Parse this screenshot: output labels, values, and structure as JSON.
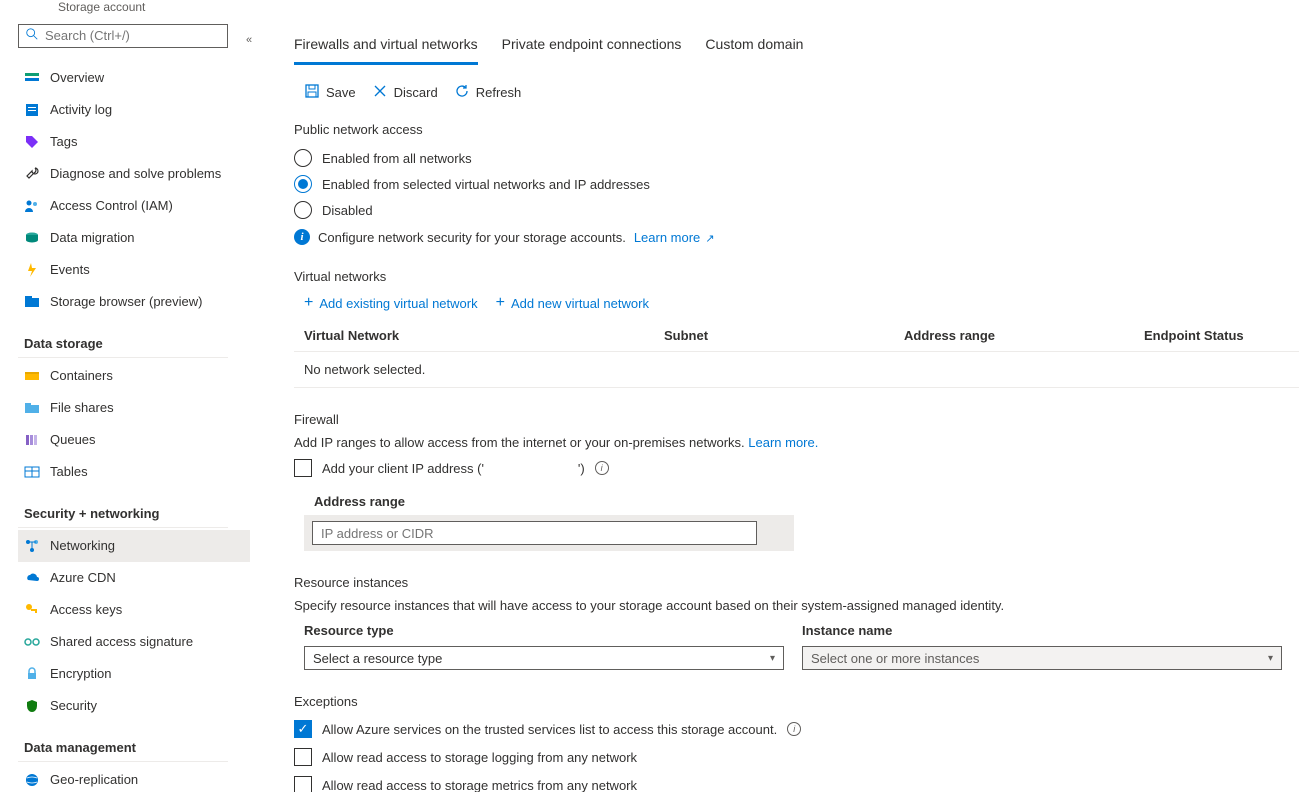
{
  "breadcrumb": "Storage account",
  "search_placeholder": "Search (Ctrl+/)",
  "sidebar": {
    "items_top": [
      {
        "label": "Overview",
        "icon": "overview"
      },
      {
        "label": "Activity log",
        "icon": "activity"
      },
      {
        "label": "Tags",
        "icon": "tag"
      },
      {
        "label": "Diagnose and solve problems",
        "icon": "wrench"
      },
      {
        "label": "Access Control (IAM)",
        "icon": "iam"
      },
      {
        "label": "Data migration",
        "icon": "migrate"
      },
      {
        "label": "Events",
        "icon": "events"
      },
      {
        "label": "Storage browser (preview)",
        "icon": "browser"
      }
    ],
    "section_data_storage": "Data storage",
    "items_data": [
      {
        "label": "Containers",
        "icon": "container"
      },
      {
        "label": "File shares",
        "icon": "fileshare"
      },
      {
        "label": "Queues",
        "icon": "queue"
      },
      {
        "label": "Tables",
        "icon": "table"
      }
    ],
    "section_security": "Security + networking",
    "items_security": [
      {
        "label": "Networking",
        "icon": "networking",
        "active": true
      },
      {
        "label": "Azure CDN",
        "icon": "cdn"
      },
      {
        "label": "Access keys",
        "icon": "key"
      },
      {
        "label": "Shared access signature",
        "icon": "sas"
      },
      {
        "label": "Encryption",
        "icon": "encryption"
      },
      {
        "label": "Security",
        "icon": "security"
      }
    ],
    "section_data_mgmt": "Data management",
    "items_mgmt": [
      {
        "label": "Geo-replication",
        "icon": "geo"
      }
    ]
  },
  "tabs": [
    "Firewalls and virtual networks",
    "Private endpoint connections",
    "Custom domain"
  ],
  "toolbar": {
    "save": "Save",
    "discard": "Discard",
    "refresh": "Refresh"
  },
  "public_access": {
    "title": "Public network access",
    "options": [
      "Enabled from all networks",
      "Enabled from selected virtual networks and IP addresses",
      "Disabled"
    ],
    "info_text": "Configure network security for your storage accounts.",
    "learn_more": "Learn more"
  },
  "vnet": {
    "title": "Virtual networks",
    "add_existing": "Add existing virtual network",
    "add_new": "Add new virtual network",
    "headers": [
      "Virtual Network",
      "Subnet",
      "Address range",
      "Endpoint Status"
    ],
    "empty": "No network selected."
  },
  "firewall": {
    "title": "Firewall",
    "desc": "Add IP ranges to allow access from the internet or your on-premises networks.",
    "learn_more": "Learn more.",
    "client_ip_label_prefix": "Add your client IP address ('",
    "client_ip_label_suffix": "')",
    "address_range_label": "Address range",
    "ip_placeholder": "IP address or CIDR"
  },
  "resource": {
    "title": "Resource instances",
    "desc": "Specify resource instances that will have access to your storage account based on their system-assigned managed identity.",
    "type_label": "Resource type",
    "instance_label": "Instance name",
    "type_placeholder": "Select a resource type",
    "instance_placeholder": "Select one or more instances"
  },
  "exceptions": {
    "title": "Exceptions",
    "items": [
      {
        "label": "Allow Azure services on the trusted services list to access this storage account.",
        "checked": true,
        "help": true
      },
      {
        "label": "Allow read access to storage logging from any network",
        "checked": false
      },
      {
        "label": "Allow read access to storage metrics from any network",
        "checked": false
      }
    ]
  }
}
